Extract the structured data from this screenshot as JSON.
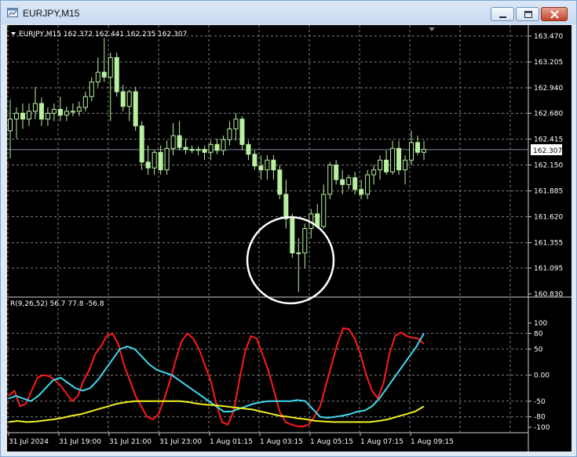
{
  "window": {
    "title": "EURJPY,M15"
  },
  "main_chart": {
    "header": "EURJPY,M15  162.372 162.441 162.235 162.307",
    "price_labels": [
      "163.470",
      "163.205",
      "162.940",
      "162.680",
      "162.415",
      "162.150",
      "161.885",
      "161.620",
      "161.355",
      "161.095",
      "160.830"
    ],
    "current_price": "162.307"
  },
  "indicator": {
    "header": "R(9,26,52) 56.7 77.8 -56.8",
    "scale_labels": [
      "100",
      "80",
      "50",
      "0.00",
      "-50",
      "-80",
      "-100"
    ]
  },
  "time_labels": [
    "31 Jul 2024",
    "31 Jul 19:00",
    "31 Jul 21:00",
    "31 Jul 23:00",
    "1 Aug 01:15",
    "1 Aug 03:15",
    "1 Aug 05:15",
    "1 Aug 07:15",
    "1 Aug 09:15"
  ],
  "colors": {
    "background": "#000000",
    "candle": "#b8f0a0",
    "grid": "#7f7f7f",
    "price_line": "#7a8aa0",
    "red_line": "#ff1a1a",
    "cyan_line": "#40d8f0",
    "yellow_line": "#f0f020",
    "highlight": "#ffffff"
  },
  "chart_data": {
    "type": "candlestick",
    "price_ylim": [
      160.83,
      163.47
    ],
    "price_bars": [
      [
        162.5,
        162.82,
        162.22,
        162.62
      ],
      [
        162.62,
        162.74,
        162.42,
        162.68
      ],
      [
        162.68,
        162.78,
        162.52,
        162.62
      ],
      [
        162.62,
        162.78,
        162.55,
        162.7
      ],
      [
        162.7,
        162.95,
        162.62,
        162.78
      ],
      [
        162.78,
        162.84,
        162.55,
        162.62
      ],
      [
        162.62,
        162.74,
        162.55,
        162.68
      ],
      [
        162.68,
        162.78,
        162.6,
        162.72
      ],
      [
        162.72,
        162.85,
        162.6,
        162.66
      ],
      [
        162.66,
        162.75,
        162.6,
        162.7
      ],
      [
        162.7,
        162.78,
        162.65,
        162.7
      ],
      [
        162.7,
        162.8,
        162.65,
        162.74
      ],
      [
        162.74,
        162.9,
        162.7,
        162.85
      ],
      [
        162.85,
        163.05,
        162.8,
        163.0
      ],
      [
        163.0,
        163.25,
        162.95,
        163.1
      ],
      [
        163.1,
        163.45,
        163.0,
        163.05
      ],
      [
        163.05,
        163.3,
        162.6,
        163.25
      ],
      [
        163.25,
        163.3,
        162.85,
        162.9
      ],
      [
        162.9,
        162.97,
        162.7,
        162.75
      ],
      [
        162.75,
        162.92,
        162.6,
        162.9
      ],
      [
        162.9,
        162.95,
        162.5,
        162.55
      ],
      [
        162.55,
        162.6,
        162.1,
        162.18
      ],
      [
        162.18,
        162.35,
        162.05,
        162.12
      ],
      [
        162.12,
        162.3,
        162.05,
        162.28
      ],
      [
        162.28,
        162.35,
        162.05,
        162.1
      ],
      [
        162.1,
        162.4,
        162.05,
        162.32
      ],
      [
        162.32,
        162.58,
        162.25,
        162.45
      ],
      [
        162.45,
        162.6,
        162.3,
        162.33
      ],
      [
        162.33,
        162.42,
        162.26,
        162.31
      ],
      [
        162.31,
        162.35,
        162.27,
        162.3
      ],
      [
        162.3,
        162.34,
        162.25,
        162.31
      ],
      [
        162.31,
        162.35,
        162.2,
        162.28
      ],
      [
        162.28,
        162.4,
        162.2,
        162.36
      ],
      [
        162.36,
        162.42,
        162.26,
        162.3
      ],
      [
        162.3,
        162.45,
        162.25,
        162.41
      ],
      [
        162.41,
        162.6,
        162.35,
        162.52
      ],
      [
        162.52,
        162.68,
        162.4,
        162.62
      ],
      [
        162.62,
        162.65,
        162.3,
        162.36
      ],
      [
        162.36,
        162.4,
        162.2,
        162.26
      ],
      [
        162.26,
        162.3,
        162.1,
        162.14
      ],
      [
        162.14,
        162.25,
        162.0,
        162.1
      ],
      [
        162.1,
        162.25,
        162.0,
        162.2
      ],
      [
        162.2,
        162.25,
        162.0,
        162.1
      ],
      [
        162.1,
        162.15,
        161.8,
        161.85
      ],
      [
        161.85,
        162.0,
        161.5,
        161.6
      ],
      [
        161.6,
        161.65,
        161.2,
        161.25
      ],
      [
        161.25,
        161.4,
        160.85,
        161.25
      ],
      [
        161.25,
        161.55,
        161.1,
        161.5
      ],
      [
        161.5,
        161.7,
        161.4,
        161.65
      ],
      [
        161.65,
        161.75,
        161.5,
        161.52
      ],
      [
        161.52,
        161.95,
        161.5,
        161.85
      ],
      [
        161.85,
        162.18,
        161.8,
        162.15
      ],
      [
        162.15,
        162.2,
        161.95,
        162.0
      ],
      [
        162.0,
        162.1,
        161.85,
        161.95
      ],
      [
        161.95,
        162.05,
        161.9,
        162.02
      ],
      [
        162.02,
        162.08,
        161.85,
        161.9
      ],
      [
        161.9,
        162.0,
        161.8,
        161.85
      ],
      [
        161.85,
        162.1,
        161.8,
        162.05
      ],
      [
        162.05,
        162.15,
        161.95,
        162.1
      ],
      [
        162.1,
        162.25,
        162.0,
        162.2
      ],
      [
        162.2,
        162.3,
        162.05,
        162.08
      ],
      [
        162.08,
        162.4,
        162.05,
        162.32
      ],
      [
        162.32,
        162.4,
        162.05,
        162.1
      ],
      [
        162.1,
        162.25,
        161.95,
        162.2
      ],
      [
        162.2,
        162.5,
        162.15,
        162.38
      ],
      [
        162.38,
        162.45,
        162.25,
        162.28
      ],
      [
        162.28,
        162.4,
        162.2,
        162.31
      ]
    ],
    "indicator_ylim": [
      -100,
      100
    ],
    "series": [
      {
        "values": [
          -40,
          -30,
          -60,
          -55,
          -30,
          -5,
          0,
          -2,
          -10,
          -20,
          -35,
          -50,
          -40,
          -10,
          10,
          40,
          55,
          75,
          80,
          60,
          20,
          -10,
          -40,
          -60,
          -80,
          -85,
          -75,
          -45,
          -10,
          30,
          65,
          80,
          70,
          50,
          20,
          -10,
          -55,
          -90,
          -95,
          -70,
          -10,
          45,
          75,
          70,
          40,
          10,
          -30,
          -70,
          -90,
          -95,
          -98,
          -99,
          -95,
          -80,
          -60,
          -20,
          20,
          60,
          90,
          88,
          70,
          40,
          0,
          -30,
          -45,
          -15,
          40,
          75,
          82,
          75,
          72,
          70,
          60
        ]
      },
      {
        "values": [
          -45,
          -40,
          -45,
          -50,
          -40,
          -25,
          -10,
          -5,
          -15,
          -25,
          -30,
          -25,
          -10,
          10,
          30,
          50,
          55,
          50,
          35,
          20,
          10,
          5,
          0,
          -10,
          -20,
          -30,
          -40,
          -50,
          -60,
          -70,
          -70,
          -65,
          -60,
          -55,
          -52,
          -50,
          -50,
          -50,
          -50,
          -48,
          -50,
          -65,
          -80,
          -82,
          -80,
          -78,
          -75,
          -70,
          -68,
          -60,
          -45,
          -25,
          -5,
          15,
          35,
          55,
          80
        ]
      },
      {
        "values": [
          -90,
          -88,
          -90,
          -89,
          -87,
          -85,
          -82,
          -78,
          -75,
          -70,
          -65,
          -60,
          -55,
          -52,
          -50,
          -50,
          -50,
          -50,
          -50,
          -50,
          -52,
          -55,
          -57,
          -58,
          -60,
          -62,
          -64,
          -66,
          -70,
          -74,
          -78,
          -80,
          -83,
          -85,
          -88,
          -89,
          -90,
          -90,
          -90,
          -90,
          -90,
          -88,
          -85,
          -80,
          -75,
          -70,
          -60
        ]
      }
    ]
  }
}
